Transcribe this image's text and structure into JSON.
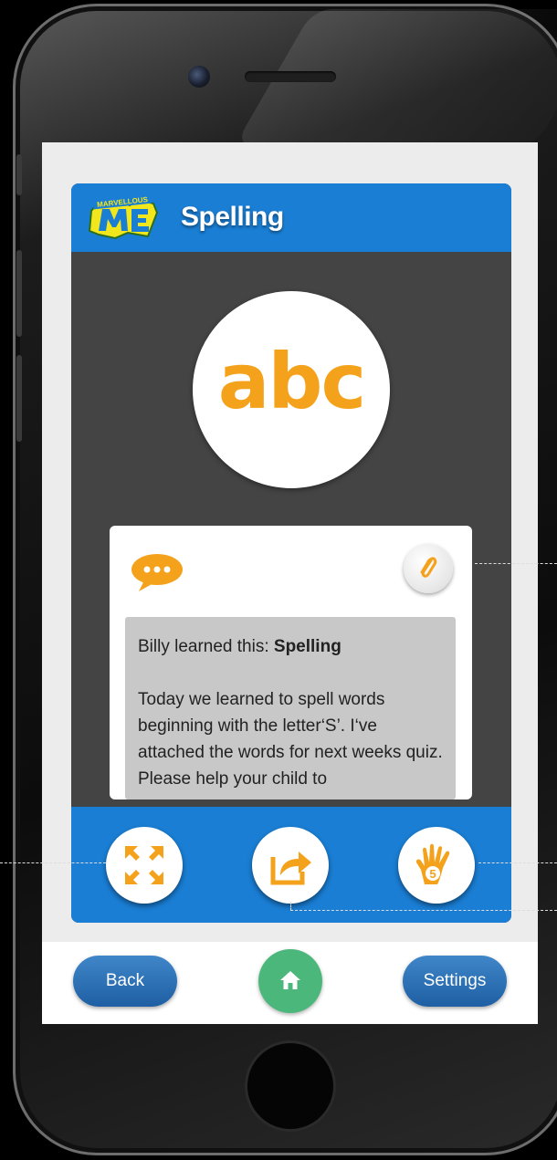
{
  "app": {
    "logo_text_top": "MARVELLOUS",
    "logo_text_main": "ME"
  },
  "header": {
    "title": "Spelling"
  },
  "badge": {
    "text": "abc"
  },
  "note": {
    "learned_prefix": "Billy learned this: ",
    "learned_topic": "Spelling",
    "message": "Today we learned to spell words beginning with the letter‘S’. I‘ve attached the words for next weeks quiz. Please help your child to"
  },
  "actions": {
    "expand_icon": "expand-icon",
    "share_icon": "share-icon",
    "highfive_icon": "high-five-icon",
    "highfive_number": "5",
    "attachment_icon": "paperclip-icon",
    "comment_icon": "speech-bubble-icon"
  },
  "nav": {
    "back_label": "Back",
    "settings_label": "Settings",
    "home_icon": "home-icon"
  },
  "colors": {
    "brand_blue": "#1a7ed4",
    "accent_orange": "#f4a21b",
    "home_green": "#4cb77a",
    "logo_yellow": "#f2e61c"
  }
}
